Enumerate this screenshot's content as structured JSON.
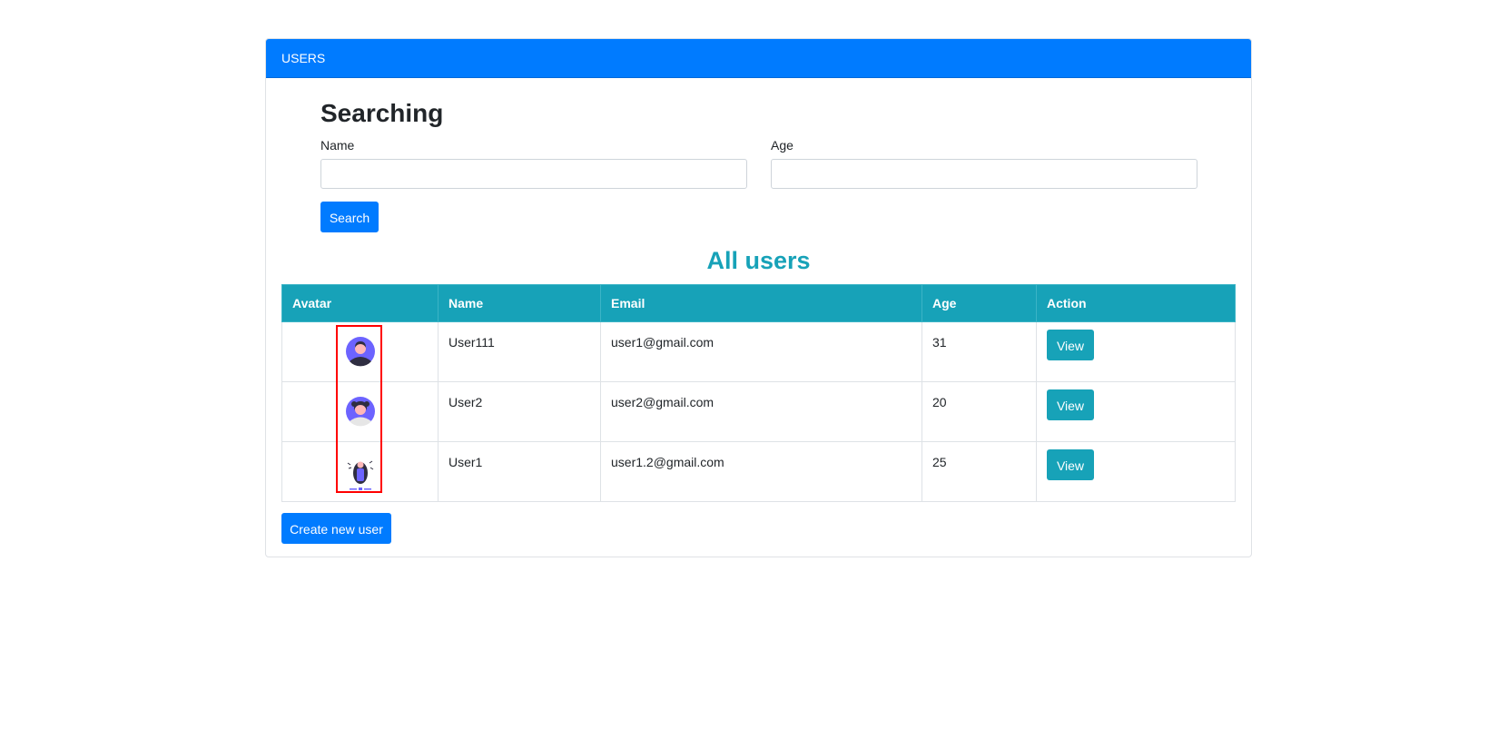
{
  "header": {
    "title": "USERS"
  },
  "search": {
    "title": "Searching",
    "name_label": "Name",
    "name_value": "",
    "age_label": "Age",
    "age_value": "",
    "button_label": "Search"
  },
  "table": {
    "title": "All users",
    "headers": [
      "Avatar",
      "Name",
      "Email",
      "Age",
      "Action"
    ],
    "rows": [
      {
        "avatar": "user-avatar-male-icon",
        "name": "User111",
        "email": "user1@gmail.com",
        "age": "31",
        "action": "View"
      },
      {
        "avatar": "user-avatar-female-icon",
        "name": "User2",
        "email": "user2@gmail.com",
        "age": "20",
        "action": "View"
      },
      {
        "avatar": "user-illustration-icon",
        "name": "User1",
        "email": "user1.2@gmail.com",
        "age": "25",
        "action": "View"
      }
    ]
  },
  "footer": {
    "create_label": "Create new user"
  },
  "colors": {
    "primary": "#007bff",
    "info": "#17a2b8",
    "highlight": "#ff0000"
  }
}
